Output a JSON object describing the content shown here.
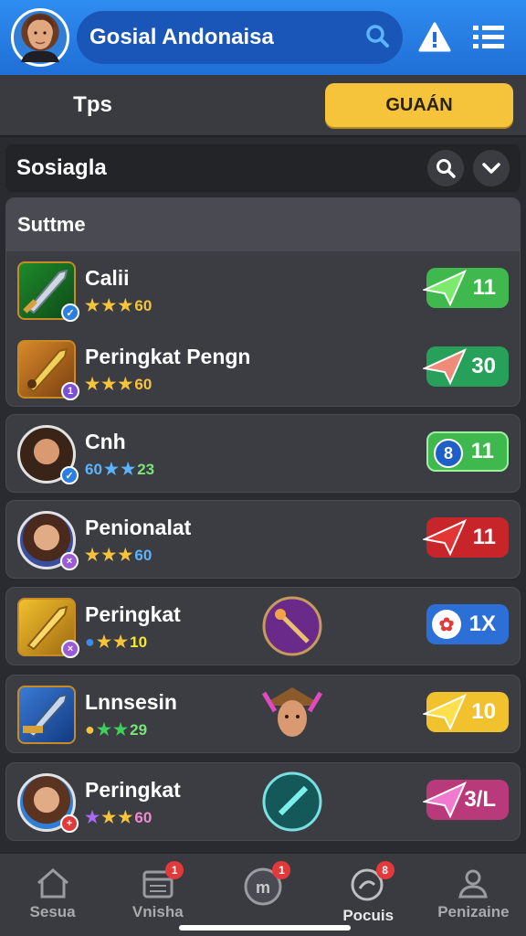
{
  "header": {
    "title": "Gosial Andonaisa"
  },
  "tabs": {
    "left_label": "Tps",
    "right_label": "GUAÁN"
  },
  "section": {
    "label": "Sosiagla"
  },
  "group": {
    "label": "Suttme"
  },
  "rows": [
    {
      "name": "Calii",
      "stat": "60",
      "value": "11",
      "pill_color": "#3fb94e",
      "arrow_color": "#7bea6d"
    },
    {
      "name": "Peringkat Pengn",
      "stat": "60",
      "value": "30",
      "pill_color": "#27a05a",
      "arrow_color": "#f08a7a"
    },
    {
      "name": "Cnh",
      "stat_left": "60",
      "stat": "23",
      "value": "11",
      "pill_color": "#3fb94e",
      "badge_text": "8"
    },
    {
      "name": "Penionalat",
      "stat": "60",
      "value": "11",
      "pill_color": "#c8252b",
      "arrow_color": "#e43535"
    },
    {
      "name": "Peringkat",
      "stat": "10",
      "value": "1X",
      "pill_color": "#2c6fd6"
    },
    {
      "name": "Lnnsesin",
      "stat": "29",
      "value": "10",
      "pill_color": "#f2c12e",
      "arrow_color": "#fde04e"
    },
    {
      "name": "Peringkat",
      "stat": "60",
      "value": "3/L",
      "pill_color": "#b93a7a",
      "arrow_color": "#f07ad0"
    }
  ],
  "bottom_nav": [
    {
      "label": "Sesua",
      "icon": "home-icon"
    },
    {
      "label": "Vnisha",
      "icon": "calendar-icon",
      "badge": "1"
    },
    {
      "label": "",
      "icon": "logo-icon",
      "badge": "1"
    },
    {
      "label": "Pocuis",
      "icon": "quest-icon",
      "badge": "8"
    },
    {
      "label": "Penizaine",
      "icon": "profile-icon"
    }
  ],
  "colors": {
    "accent": "#2f8cf0",
    "gold": "#f5c43a",
    "background": "#2a2b30"
  }
}
